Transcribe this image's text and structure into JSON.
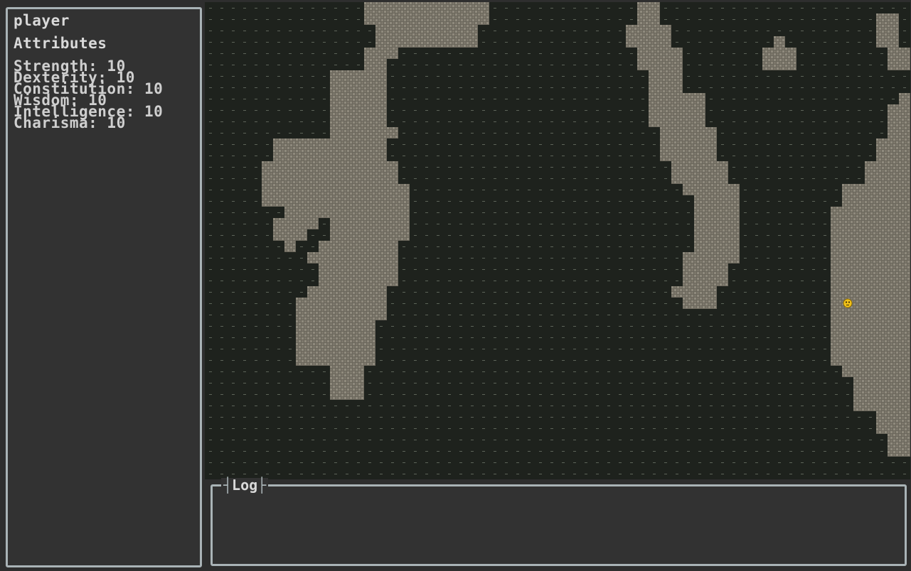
{
  "character_panel": {
    "name": "player",
    "attributes_heading": "Attributes",
    "attributes": [
      {
        "label": "Strength: 10"
      },
      {
        "label": "Dexterity: 10"
      },
      {
        "label": "Constitution: 10"
      },
      {
        "label": "Wisdom: 10"
      },
      {
        "label": "Intelligence: 10"
      },
      {
        "label": "Charisma: 10"
      }
    ]
  },
  "log_panel": {
    "title": "Log",
    "messages": []
  },
  "map": {
    "grid": {
      "columns": 62,
      "rows": 42
    },
    "legend": {
      "wall": {
        "icon": "hatched-wall-tile-icon",
        "color": "#7c776b"
      },
      "floor": {
        "icon": "dot-floor-tile-icon",
        "color": "#1e221d"
      },
      "player": {
        "icon": "smiley-face-icon",
        "color": "#f2c21a"
      }
    },
    "player_cell": {
      "col": 56,
      "row": 26
    },
    "tiles": [
      "..............###########.............##......................",
      "..............###########.............##...................##.",
      "...............#########.............####..................##.",
      "...............#########.............####.........#........##.",
      "..............###.....................####.......###........##",
      "..............##......................####.......###........##",
      "...........#####.......................###....................",
      "...........#####.......................###....................",
      "...........#####.......................#####.................#",
      "...........#####.......................#####................##",
      "...........#####.......................#####................##",
      "...........######.......................#####...............##",
      "......##########........................#####..............###",
      "......##########........................#####..............###",
      ".....############........................#####............####",
      ".....############........................#####............####",
      ".....#############........................#####.........######",
      ".....#############.........................####.........######",
      ".......###########.........................####........#######",
      "......####.#######.........................####........#######",
      "......###..#######.........................####........#######",
      ".......#..#######..........................####........#######",
      ".........########.........................#####........#######",
      "..........#######.........................####.........#######",
      "..........#######.........................####.........#######",
      ".........#######.........................####..........#######",
      "........########..........................###..........#######",
      "........########.......................................#######",
      "........#######........................................#######",
      "........#######........................................#######",
      "........#######........................................#######",
      "........#######........................................#######",
      "...........###..........................................######",
      "...........###...........................................#####",
      "...........###...........................................#####",
      ".........................................................#####",
      "...........................................................###",
      "...........................................................###",
      "............................................................##",
      "............................................................##",
      "..............................................................",
      ".............................................................."
    ]
  }
}
